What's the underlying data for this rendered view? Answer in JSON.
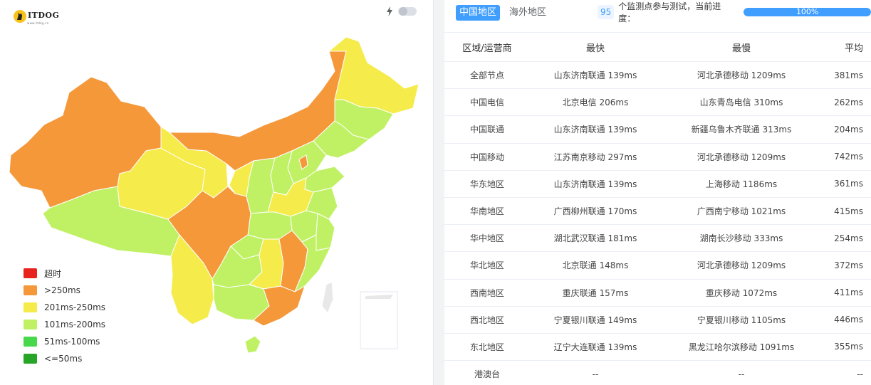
{
  "logo": {
    "text": "ITDOG",
    "subtext": "www.itdog.cn"
  },
  "theme_toggle": {
    "icon": "lightning-bolt-icon",
    "state": "off"
  },
  "map": {
    "regions_shown": "China provinces",
    "colors": {
      "timeout": "#e8231e",
      "gt250": "#f5983a",
      "r201_250": "#f5eb4a",
      "r101_200": "#c0f165",
      "r51_100": "#47d94b",
      "le50": "#26a526"
    }
  },
  "legend": [
    {
      "label": "超时",
      "color": "#e8231e"
    },
    {
      "label": ">250ms",
      "color": "#f5983a"
    },
    {
      "label": "201ms-250ms",
      "color": "#f5eb4a"
    },
    {
      "label": "101ms-200ms",
      "color": "#c0f165"
    },
    {
      "label": "51ms-100ms",
      "color": "#47d94b"
    },
    {
      "label": "<=50ms",
      "color": "#26a526"
    }
  ],
  "tabs": [
    {
      "label": "中国地区",
      "active": true
    },
    {
      "label": "海外地区",
      "active": false
    }
  ],
  "progress": {
    "count": "95",
    "text": "个监测点参与测试，当前进度：",
    "percent": 100,
    "label": "100%"
  },
  "table": {
    "headers": {
      "region": "区域/运营商",
      "fastest": "最快",
      "slowest": "最慢",
      "average": "平均"
    },
    "rows": [
      {
        "region": "全部节点",
        "fastest": "山东济南联通 139ms",
        "slowest": "河北承德移动 1209ms",
        "average": "381ms"
      },
      {
        "region": "中国电信",
        "fastest": "北京电信 206ms",
        "slowest": "山东青岛电信 310ms",
        "average": "262ms"
      },
      {
        "region": "中国联通",
        "fastest": "山东济南联通 139ms",
        "slowest": "新疆乌鲁木齐联通 313ms",
        "average": "204ms"
      },
      {
        "region": "中国移动",
        "fastest": "江苏南京移动 297ms",
        "slowest": "河北承德移动 1209ms",
        "average": "742ms"
      },
      {
        "region": "华东地区",
        "fastest": "山东济南联通 139ms",
        "slowest": "上海移动 1186ms",
        "average": "361ms"
      },
      {
        "region": "华南地区",
        "fastest": "广西柳州联通 170ms",
        "slowest": "广西南宁移动 1021ms",
        "average": "415ms"
      },
      {
        "region": "华中地区",
        "fastest": "湖北武汉联通 181ms",
        "slowest": "湖南长沙移动 333ms",
        "average": "254ms"
      },
      {
        "region": "华北地区",
        "fastest": "北京联通 148ms",
        "slowest": "河北承德移动 1209ms",
        "average": "372ms"
      },
      {
        "region": "西南地区",
        "fastest": "重庆联通 157ms",
        "slowest": "重庆移动 1072ms",
        "average": "411ms"
      },
      {
        "region": "西北地区",
        "fastest": "宁夏银川联通 149ms",
        "slowest": "宁夏银川移动 1105ms",
        "average": "446ms"
      },
      {
        "region": "东北地区",
        "fastest": "辽宁大连联通 139ms",
        "slowest": "黑龙江哈尔滨移动 1091ms",
        "average": "355ms"
      },
      {
        "region": "港澳台",
        "fastest": "--",
        "slowest": "--",
        "average": "--"
      }
    ]
  }
}
